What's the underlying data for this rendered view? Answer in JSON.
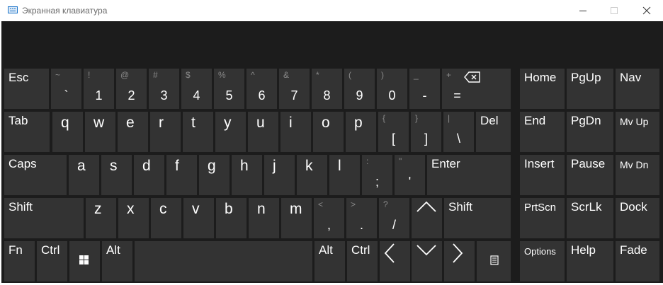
{
  "window": {
    "title": "Экранная клавиатура"
  },
  "rows": {
    "numbers": [
      {
        "id": "esc",
        "label": "Esc"
      },
      {
        "id": "backtick",
        "shift": "~",
        "main": "`"
      },
      {
        "id": "1",
        "shift": "!",
        "main": "1"
      },
      {
        "id": "2",
        "shift": "@",
        "main": "2"
      },
      {
        "id": "3",
        "shift": "#",
        "main": "3"
      },
      {
        "id": "4",
        "shift": "$",
        "main": "4"
      },
      {
        "id": "5",
        "shift": "%",
        "main": "5"
      },
      {
        "id": "6",
        "shift": "^",
        "main": "6"
      },
      {
        "id": "7",
        "shift": "&",
        "main": "7"
      },
      {
        "id": "8",
        "shift": "*",
        "main": "8"
      },
      {
        "id": "9",
        "shift": "(",
        "main": "9"
      },
      {
        "id": "0",
        "shift": ")",
        "main": "0"
      },
      {
        "id": "minus",
        "shift": "_",
        "main": "-"
      },
      {
        "id": "equals",
        "shift": "+",
        "main": "="
      }
    ],
    "qwerty": [
      {
        "id": "tab",
        "label": "Tab"
      },
      {
        "id": "q",
        "main": "q"
      },
      {
        "id": "w",
        "main": "w"
      },
      {
        "id": "e",
        "main": "e"
      },
      {
        "id": "r",
        "main": "r"
      },
      {
        "id": "t",
        "main": "t"
      },
      {
        "id": "y",
        "main": "y"
      },
      {
        "id": "u",
        "main": "u"
      },
      {
        "id": "i",
        "main": "i"
      },
      {
        "id": "o",
        "main": "o"
      },
      {
        "id": "p",
        "main": "p"
      },
      {
        "id": "lbracket",
        "shift": "{",
        "main": "["
      },
      {
        "id": "rbracket",
        "shift": "}",
        "main": "]"
      },
      {
        "id": "backslash",
        "shift": "|",
        "main": "\\"
      },
      {
        "id": "del",
        "label": "Del"
      }
    ],
    "home": [
      {
        "id": "caps",
        "label": "Caps"
      },
      {
        "id": "a",
        "main": "a"
      },
      {
        "id": "s",
        "main": "s"
      },
      {
        "id": "d",
        "main": "d"
      },
      {
        "id": "f",
        "main": "f"
      },
      {
        "id": "g",
        "main": "g"
      },
      {
        "id": "h",
        "main": "h"
      },
      {
        "id": "j",
        "main": "j"
      },
      {
        "id": "k",
        "main": "k"
      },
      {
        "id": "l",
        "main": "l"
      },
      {
        "id": "semicolon",
        "shift": ":",
        "main": ";"
      },
      {
        "id": "quote",
        "shift": "\"",
        "main": "'"
      },
      {
        "id": "enter",
        "label": "Enter"
      }
    ],
    "shift": [
      {
        "id": "lshift",
        "label": "Shift"
      },
      {
        "id": "z",
        "main": "z"
      },
      {
        "id": "x",
        "main": "x"
      },
      {
        "id": "c",
        "main": "c"
      },
      {
        "id": "v",
        "main": "v"
      },
      {
        "id": "b",
        "main": "b"
      },
      {
        "id": "n",
        "main": "n"
      },
      {
        "id": "m",
        "main": "m"
      },
      {
        "id": "comma",
        "shift": "<",
        "main": ","
      },
      {
        "id": "period",
        "shift": ">",
        "main": "."
      },
      {
        "id": "slash",
        "shift": "?",
        "main": "/"
      },
      {
        "id": "rshift",
        "label": "Shift"
      }
    ],
    "bottom": [
      {
        "id": "fn",
        "label": "Fn"
      },
      {
        "id": "lctrl",
        "label": "Ctrl"
      },
      {
        "id": "lalt",
        "label": "Alt"
      },
      {
        "id": "ralt",
        "label": "Alt"
      },
      {
        "id": "rctrl",
        "label": "Ctrl"
      }
    ]
  },
  "nav": {
    "home": "Home",
    "pgup": "PgUp",
    "navk": "Nav",
    "end": "End",
    "pgdn": "PgDn",
    "mvup": "Mv Up",
    "insert": "Insert",
    "pause": "Pause",
    "mvdn": "Mv Dn",
    "prtscn": "PrtScn",
    "scrlk": "ScrLk",
    "dock": "Dock",
    "options": "Options",
    "help": "Help",
    "fade": "Fade"
  },
  "icons": {
    "app": "keyboard-icon",
    "backspace": "backspace-icon",
    "windows": "windows-logo-icon",
    "arrows": [
      "arrow-up-icon",
      "arrow-left-icon",
      "arrow-down-icon",
      "arrow-right-icon"
    ],
    "menu": "context-menu-icon"
  }
}
